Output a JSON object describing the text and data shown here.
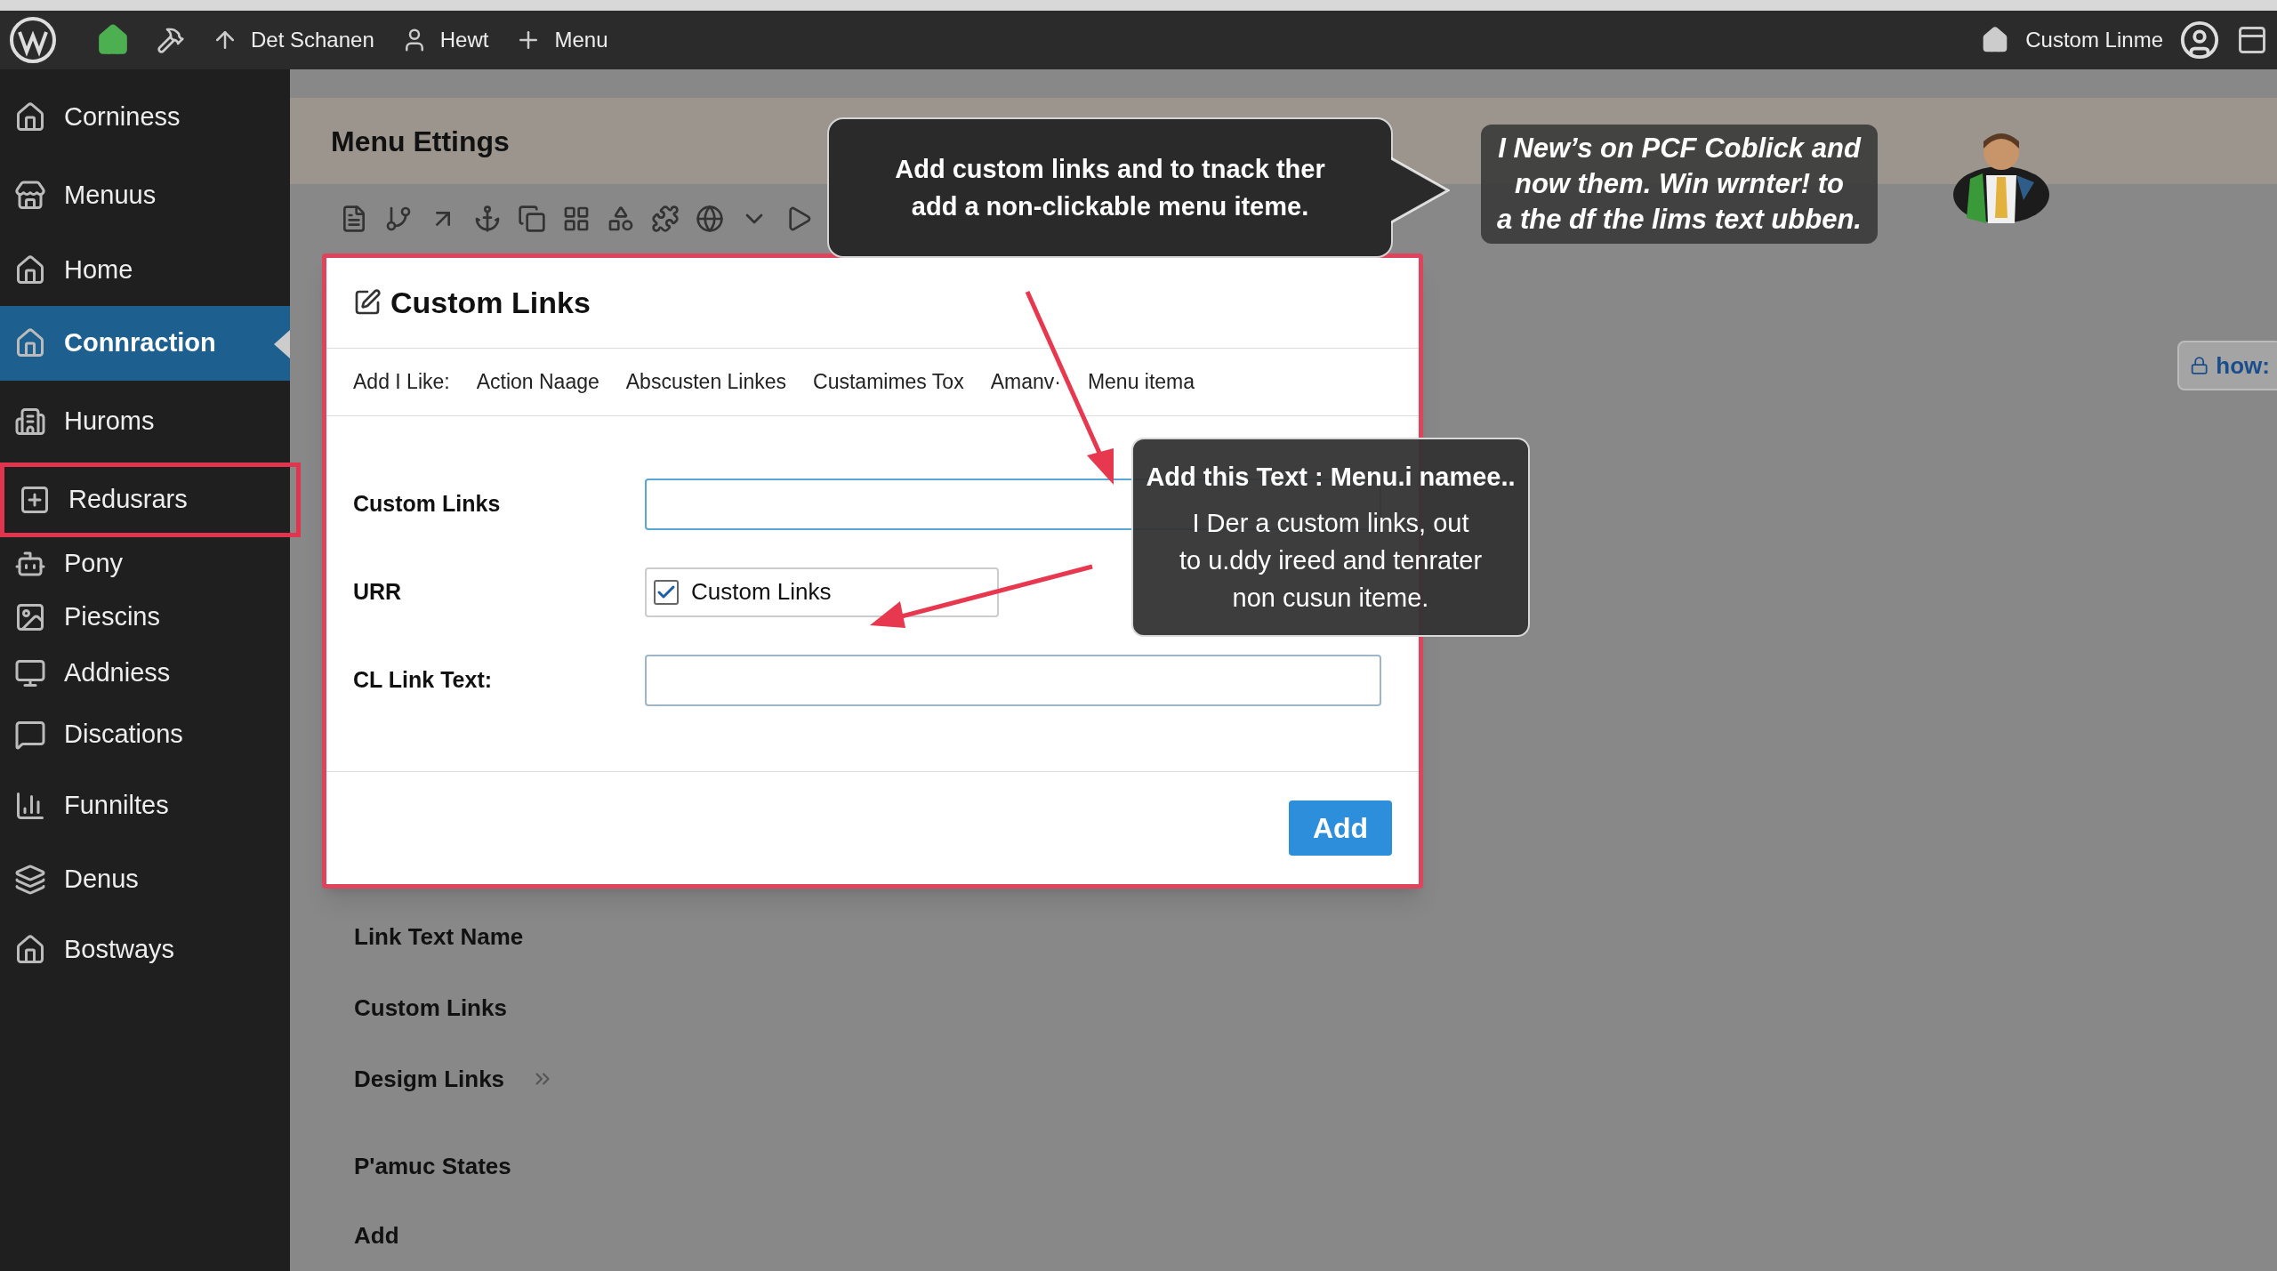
{
  "admin_bar": {
    "items": [
      {
        "kind": "up",
        "label": "Det Schanen"
      },
      {
        "kind": "user",
        "label": "Hewt"
      },
      {
        "kind": "plus",
        "label": "Menu"
      }
    ],
    "account": "Custom Linme"
  },
  "sidebar": {
    "items": [
      {
        "label": "Corniness",
        "selected": false,
        "outlined": false
      },
      {
        "label": "Menuus",
        "selected": false,
        "outlined": false
      },
      {
        "label": "Home",
        "selected": false,
        "outlined": false
      },
      {
        "label": "Connraction",
        "selected": true,
        "outlined": false
      },
      {
        "label": "Huroms",
        "selected": false,
        "outlined": false
      },
      {
        "label": "Redusrars",
        "selected": false,
        "outlined": true
      },
      {
        "label": "Pony",
        "selected": false,
        "outlined": false
      },
      {
        "label": "Piescins",
        "selected": false,
        "outlined": false
      },
      {
        "label": "Addniess",
        "selected": false,
        "outlined": false
      },
      {
        "label": "Discations",
        "selected": false,
        "outlined": false
      },
      {
        "label": "Funniltes",
        "selected": false,
        "outlined": false
      },
      {
        "label": "Denus",
        "selected": false,
        "outlined": false
      },
      {
        "label": "Bostways",
        "selected": false,
        "outlined": false
      }
    ]
  },
  "page_title": "Menu Ettings",
  "side_button": "how:",
  "dialog": {
    "title": "Custom Links",
    "tabs": [
      "Add I Like:",
      "Action Naage",
      "Abscusten Linkes",
      "Custamimes Tox",
      "Amanv·",
      "Menu itema"
    ],
    "fields": [
      {
        "kind": "input",
        "label": "Custom Links",
        "focused": true
      },
      {
        "kind": "checkbox",
        "label": "URR",
        "option": "Custom Links",
        "checked": true
      },
      {
        "kind": "input",
        "label": "CL Link Text:",
        "focused": false
      }
    ],
    "button": "Add"
  },
  "list": [
    {
      "label": "Link Text Name",
      "arrow": false
    },
    {
      "label": "Custom Links",
      "arrow": false
    },
    {
      "label": "Desigm Links",
      "arrow": true
    },
    {
      "label": "P'amuc States",
      "arrow": false
    },
    {
      "label": "Add",
      "arrow": false
    }
  ],
  "callouts": [
    {
      "kind": "pointer",
      "text": "Add custom links and to tnack ther\nadd a non-clickable menu iteme."
    },
    {
      "kind": "italic",
      "text": "I New’s on PCF Coblick and\nnow them. Win wrnter! to\na the df the lims text ubben."
    },
    {
      "kind": "titled",
      "title": "Add this Text : Menu.i namee..",
      "text": "I Der a custom links, out\nto u.ddy ireed and tenrater\nnon cusun iteme."
    }
  ]
}
